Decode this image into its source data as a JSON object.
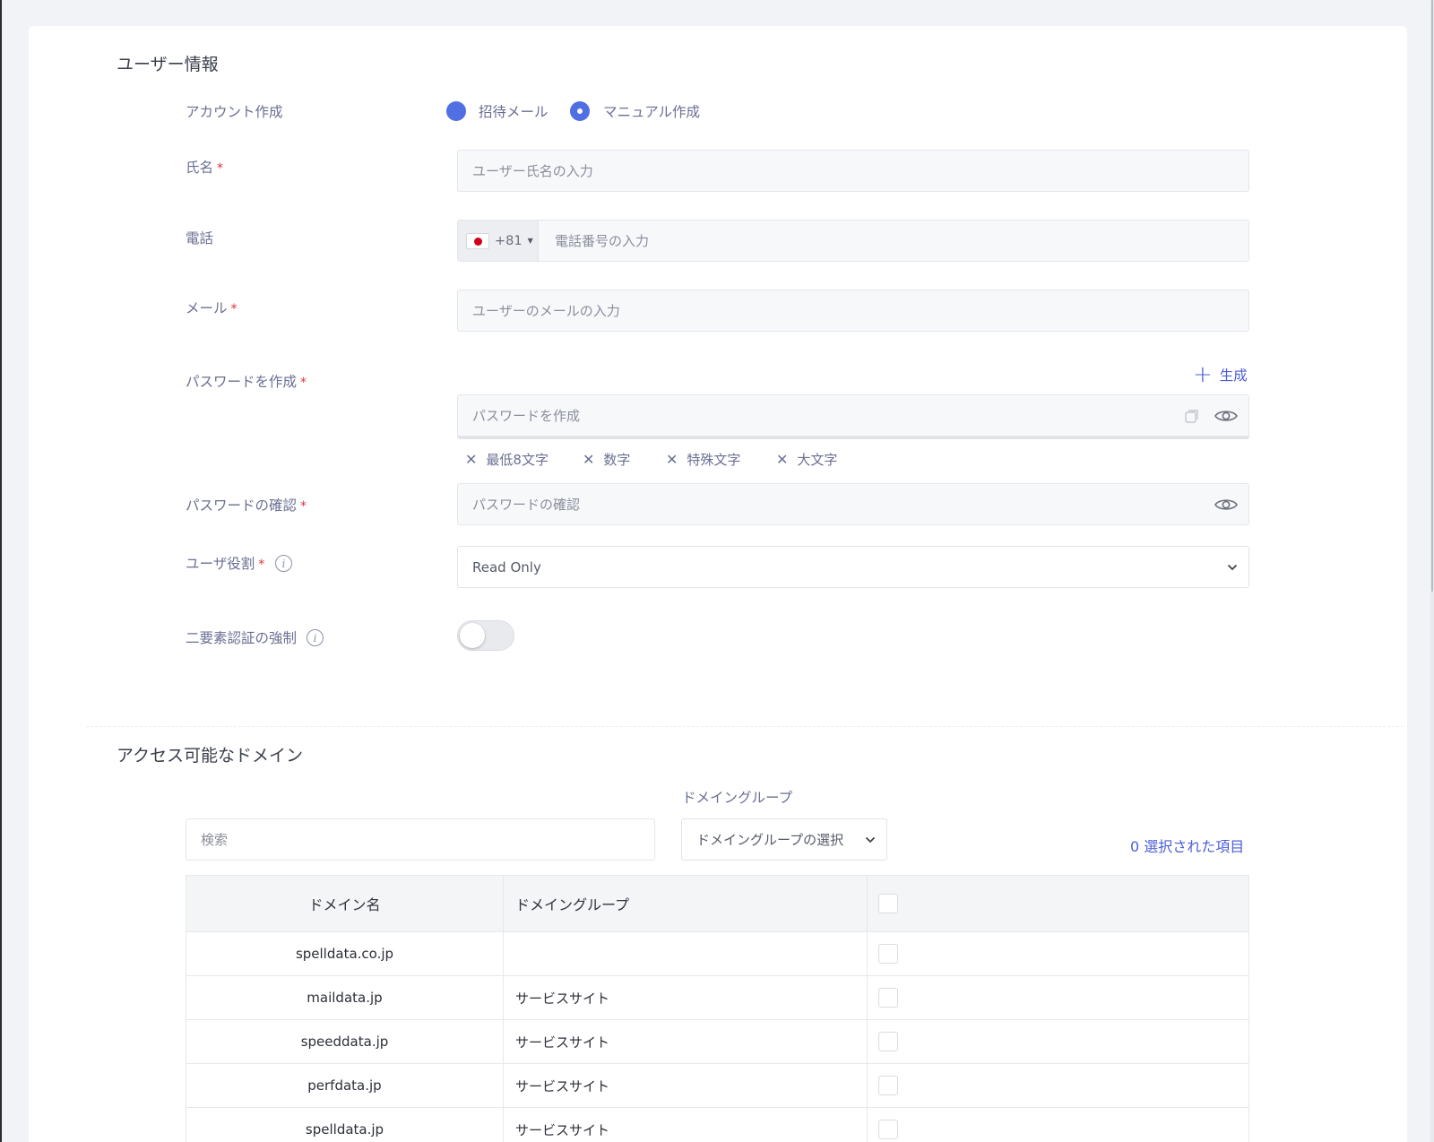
{
  "user_info": {
    "title": "ユーザー情報",
    "account_creation": {
      "label": "アカウント作成",
      "options": [
        {
          "label": "招待メール",
          "checked": false
        },
        {
          "label": "マニュアル作成",
          "checked": true
        }
      ]
    },
    "name": {
      "label": "氏名",
      "required_mark": "*",
      "placeholder": "ユーザー氏名の入力"
    },
    "phone": {
      "label": "電話",
      "country_code": "+81",
      "placeholder": "電話番号の入力"
    },
    "email": {
      "label": "メール",
      "required_mark": "*",
      "placeholder": "ユーザーのメールの入力"
    },
    "password": {
      "label": "パスワードを作成",
      "required_mark": "*",
      "generate_label": "生成",
      "placeholder": "パスワードを作成",
      "rules": [
        "最低8文字",
        "数字",
        "特殊文字",
        "大文字"
      ],
      "rule_mark": "✕"
    },
    "password_confirm": {
      "label": "パスワードの確認",
      "required_mark": "*",
      "placeholder": "パスワードの確認"
    },
    "user_role": {
      "label": "ユーザ役割",
      "required_mark": "*",
      "value": "Read Only"
    },
    "two_factor": {
      "label": "二要素認証の強制",
      "enabled": false
    }
  },
  "domains": {
    "title": "アクセス可能なドメイン",
    "search_placeholder": "検索",
    "group_filter": {
      "label": "ドメイングループ",
      "placeholder": "ドメイングループの選択"
    },
    "selected_count": "0 選択された項目",
    "columns": [
      "ドメイン名",
      "ドメイングループ"
    ],
    "rows": [
      {
        "name": "spelldata.co.jp",
        "group": ""
      },
      {
        "name": "maildata.jp",
        "group": "サービスサイト"
      },
      {
        "name": "speeddata.jp",
        "group": "サービスサイト"
      },
      {
        "name": "perfdata.jp",
        "group": "サービスサイト"
      },
      {
        "name": "spelldata.jp",
        "group": "サービスサイト"
      }
    ]
  },
  "colors": {
    "accent": "#4f6fe3",
    "required": "#e0303a",
    "label": "#6a6f93"
  },
  "icons": [
    "eye-icon",
    "copy-icon",
    "info-icon",
    "chevron-down-icon",
    "plus-icon",
    "flag-icon"
  ]
}
